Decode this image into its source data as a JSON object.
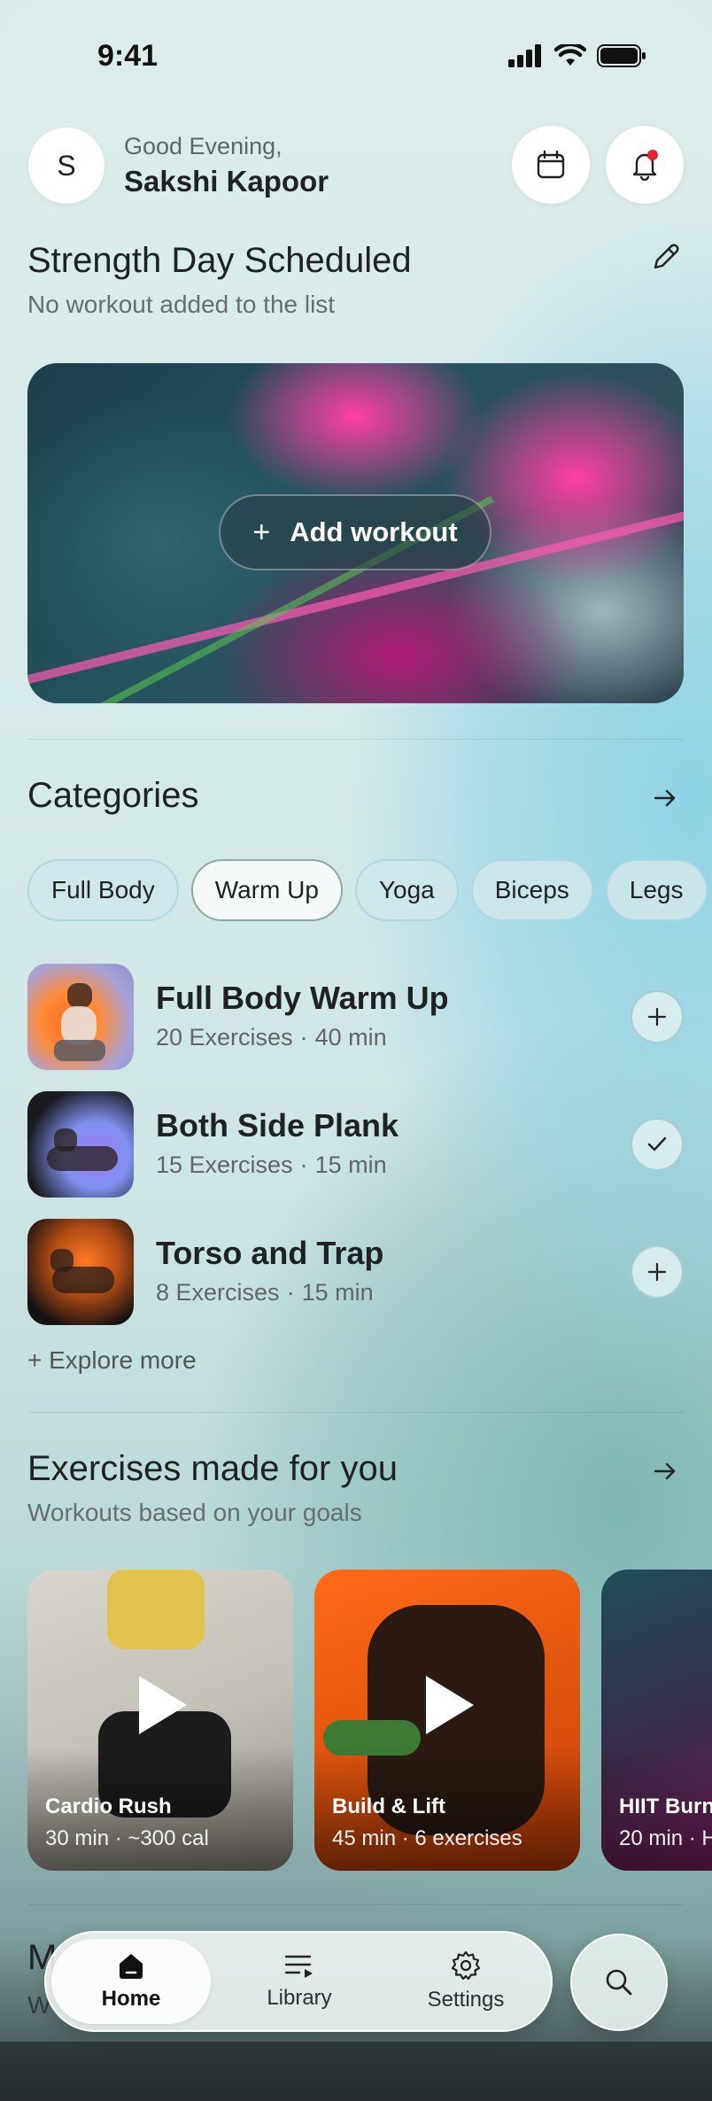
{
  "status_bar": {
    "time": "9:41"
  },
  "header": {
    "avatar_initial": "S",
    "greeting": "Good Evening,",
    "name": "Sakshi Kapoor",
    "calendar_icon": "calendar-icon",
    "bell_icon": "bell-icon",
    "notification_color": "#e8212b"
  },
  "schedule": {
    "title": "Strength Day Scheduled",
    "subtitle": "No workout added to the list",
    "edit_icon": "pencil-icon",
    "add_button": "Add workout"
  },
  "categories": {
    "title": "Categories",
    "chips": [
      "Full Body",
      "Warm Up",
      "Yoga",
      "Biceps",
      "Legs"
    ],
    "selected": "Warm Up"
  },
  "workouts": [
    {
      "title": "Full Body Warm Up",
      "exercises": "20 Exercises",
      "duration": "40 min",
      "action": "plus-icon"
    },
    {
      "title": "Both Side Plank",
      "exercises": "15 Exercises",
      "duration": "15 min",
      "action": "check-icon"
    },
    {
      "title": "Torso and Trap",
      "exercises": "8 Exercises",
      "duration": "15 min",
      "action": "plus-icon"
    }
  ],
  "explore_more": "+ Explore more",
  "recommended": {
    "title": "Exercises made for you",
    "subtitle": "Workouts based on your goals",
    "cards": [
      {
        "title": "Cardio Rush",
        "meta": "30 min · ~300 cal"
      },
      {
        "title": "Build & Lift",
        "meta": "45 min · 6 exercises"
      },
      {
        "title": "HIIT Burn",
        "meta": "20 min · H"
      }
    ]
  },
  "peek_section": {
    "title": "M",
    "subtitle": "W"
  },
  "tab_bar": {
    "tabs": [
      {
        "label": "Home",
        "icon": "home-icon"
      },
      {
        "label": "Library",
        "icon": "list-icon"
      },
      {
        "label": "Settings",
        "icon": "gear-icon"
      }
    ],
    "active": "Home",
    "search_icon": "search-icon"
  }
}
